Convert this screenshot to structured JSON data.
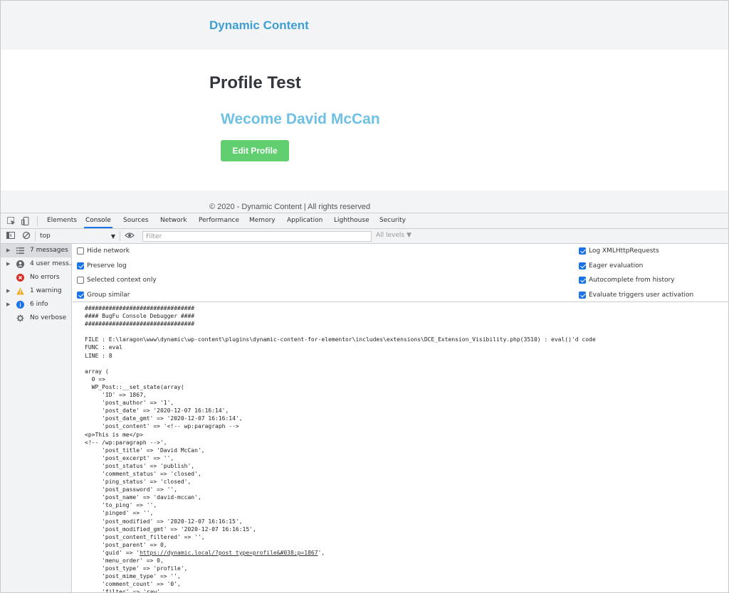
{
  "site": {
    "title": "Dynamic Content",
    "page_title": "Profile Test",
    "welcome": "Wecome David McCan",
    "edit_button": "Edit Profile",
    "footer": "© 2020 - Dynamic Content | All rights reserved"
  },
  "devtools": {
    "tabs": [
      "Elements",
      "Console",
      "Sources",
      "Network",
      "Performance",
      "Memory",
      "Application",
      "Lighthouse",
      "Security"
    ],
    "active_tab": "Console",
    "context": "top",
    "filter_placeholder": "Filter",
    "levels": "All levels ▼",
    "sidebar": [
      {
        "label": "7 messages",
        "icon": "list-icon"
      },
      {
        "label": "4 user mess...",
        "icon": "user-icon"
      },
      {
        "label": "No errors",
        "icon": "error-icon"
      },
      {
        "label": "1 warning",
        "icon": "warning-icon"
      },
      {
        "label": "6 info",
        "icon": "info-icon"
      },
      {
        "label": "No verbose",
        "icon": "verbose-icon"
      }
    ],
    "settings_left": [
      {
        "label": "Hide network",
        "checked": false
      },
      {
        "label": "Preserve log",
        "checked": true
      },
      {
        "label": "Selected context only",
        "checked": false
      },
      {
        "label": "Group similar",
        "checked": true
      }
    ],
    "settings_right": [
      {
        "label": "Log XMLHttpRequests",
        "checked": true
      },
      {
        "label": "Eager evaluation",
        "checked": true
      },
      {
        "label": "Autocomplete from history",
        "checked": true
      },
      {
        "label": "Evaluate triggers user activation",
        "checked": true
      }
    ],
    "console_lines": [
      "################################",
      "#### BugFu Console Debugger ####",
      "################################",
      "",
      "FILE : E:\\laragon\\www\\dynamic\\wp-content\\plugins\\dynamic-content-for-elementor\\includes\\extensions\\DCE_Extension_Visibility.php(3510) : eval()'d code",
      "FUNC : eval",
      "LINE : 8",
      "",
      "array (",
      "  0 =>",
      "  WP_Post::__set_state(array(",
      "     'ID' => 1867,",
      "     'post_author' => '1',",
      "     'post_date' => '2020-12-07 16:16:14',",
      "     'post_date_gmt' => '2020-12-07 16:16:14',",
      "     'post_content' => '<!-- wp:paragraph -->",
      "<p>This is me</p>",
      "<!-- /wp:paragraph -->',",
      "     'post_title' => 'David McCan',",
      "     'post_excerpt' => '',",
      "     'post_status' => 'publish',",
      "     'comment_status' => 'closed',",
      "     'ping_status' => 'closed',",
      "     'post_password' => '',",
      "     'post_name' => 'david-mccan',",
      "     'to_ping' => '',",
      "     'pinged' => '',",
      "     'post_modified' => '2020-12-07 16:16:15',",
      "     'post_modified_gmt' => '2020-12-07 16:16:15',",
      "     'post_content_filtered' => '',",
      "     'post_parent' => 0,",
      "     'guid' => 'https://dynamic.local/?post_type=profile&#038;p=1867',",
      "     'menu_order' => 0,",
      "     'post_type' => 'profile',",
      "     'post_mime_type' => '',",
      "     'comment_count' => '0',",
      "     'filter' => 'raw',"
    ],
    "guid_link": "https://dynamic.local/?post_type=profile&#038;p=1867"
  },
  "colors": {
    "brand": "#3d9fd2",
    "welcome": "#6ec1e4",
    "button": "#61ce70",
    "devtools_accent": "#1a73e8"
  }
}
